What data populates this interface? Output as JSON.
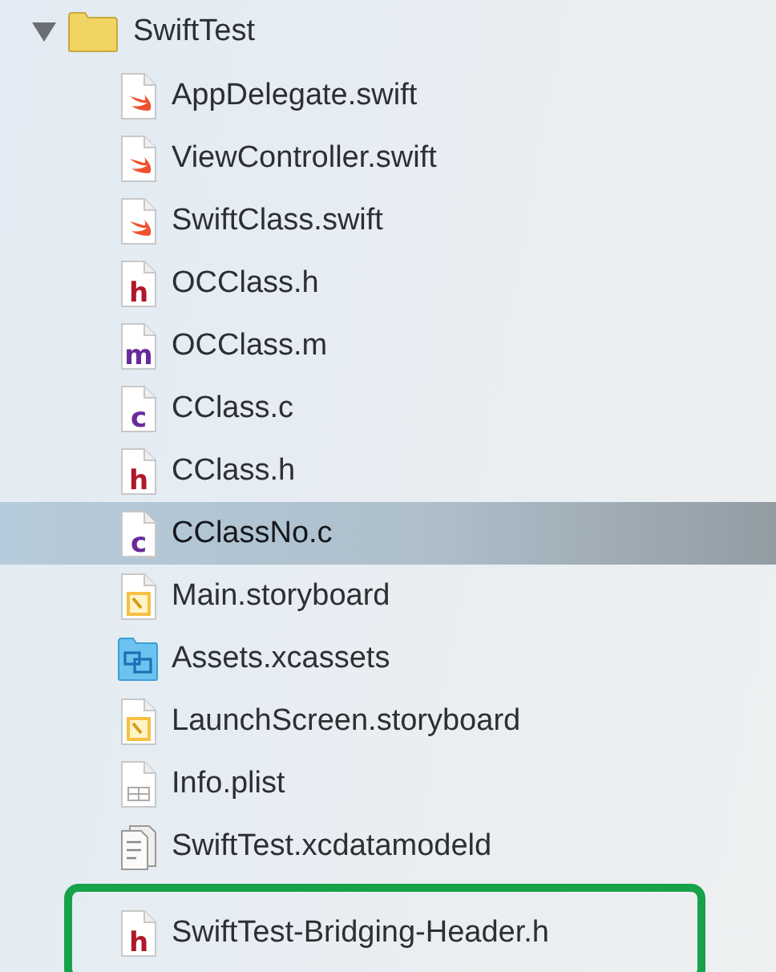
{
  "navigator": {
    "root": {
      "name": "SwiftTest",
      "kind": "folder",
      "expanded": true,
      "children": [
        {
          "name": "AppDelegate.swift",
          "kind": "swift",
          "selected": false,
          "highlighted": false
        },
        {
          "name": "ViewController.swift",
          "kind": "swift",
          "selected": false,
          "highlighted": false
        },
        {
          "name": "SwiftClass.swift",
          "kind": "swift",
          "selected": false,
          "highlighted": false
        },
        {
          "name": "OCClass.h",
          "kind": "header",
          "badge": "h",
          "selected": false,
          "highlighted": false
        },
        {
          "name": "OCClass.m",
          "kind": "objc",
          "badge": "m",
          "selected": false,
          "highlighted": false
        },
        {
          "name": "CClass.c",
          "kind": "c",
          "badge": "c",
          "selected": false,
          "highlighted": false
        },
        {
          "name": "CClass.h",
          "kind": "header",
          "badge": "h",
          "selected": false,
          "highlighted": false
        },
        {
          "name": "CClassNo.c",
          "kind": "c",
          "badge": "c",
          "selected": true,
          "highlighted": false
        },
        {
          "name": "Main.storyboard",
          "kind": "storyboard",
          "selected": false,
          "highlighted": false
        },
        {
          "name": "Assets.xcassets",
          "kind": "assets",
          "selected": false,
          "highlighted": false
        },
        {
          "name": "LaunchScreen.storyboard",
          "kind": "storyboard",
          "selected": false,
          "highlighted": false
        },
        {
          "name": "Info.plist",
          "kind": "plist",
          "selected": false,
          "highlighted": false
        },
        {
          "name": "SwiftTest.xcdatamodeld",
          "kind": "datamodel",
          "selected": false,
          "highlighted": false
        },
        {
          "name": "SwiftTest-Bridging-Header.h",
          "kind": "header",
          "badge": "h",
          "selected": false,
          "highlighted": true
        }
      ]
    }
  }
}
